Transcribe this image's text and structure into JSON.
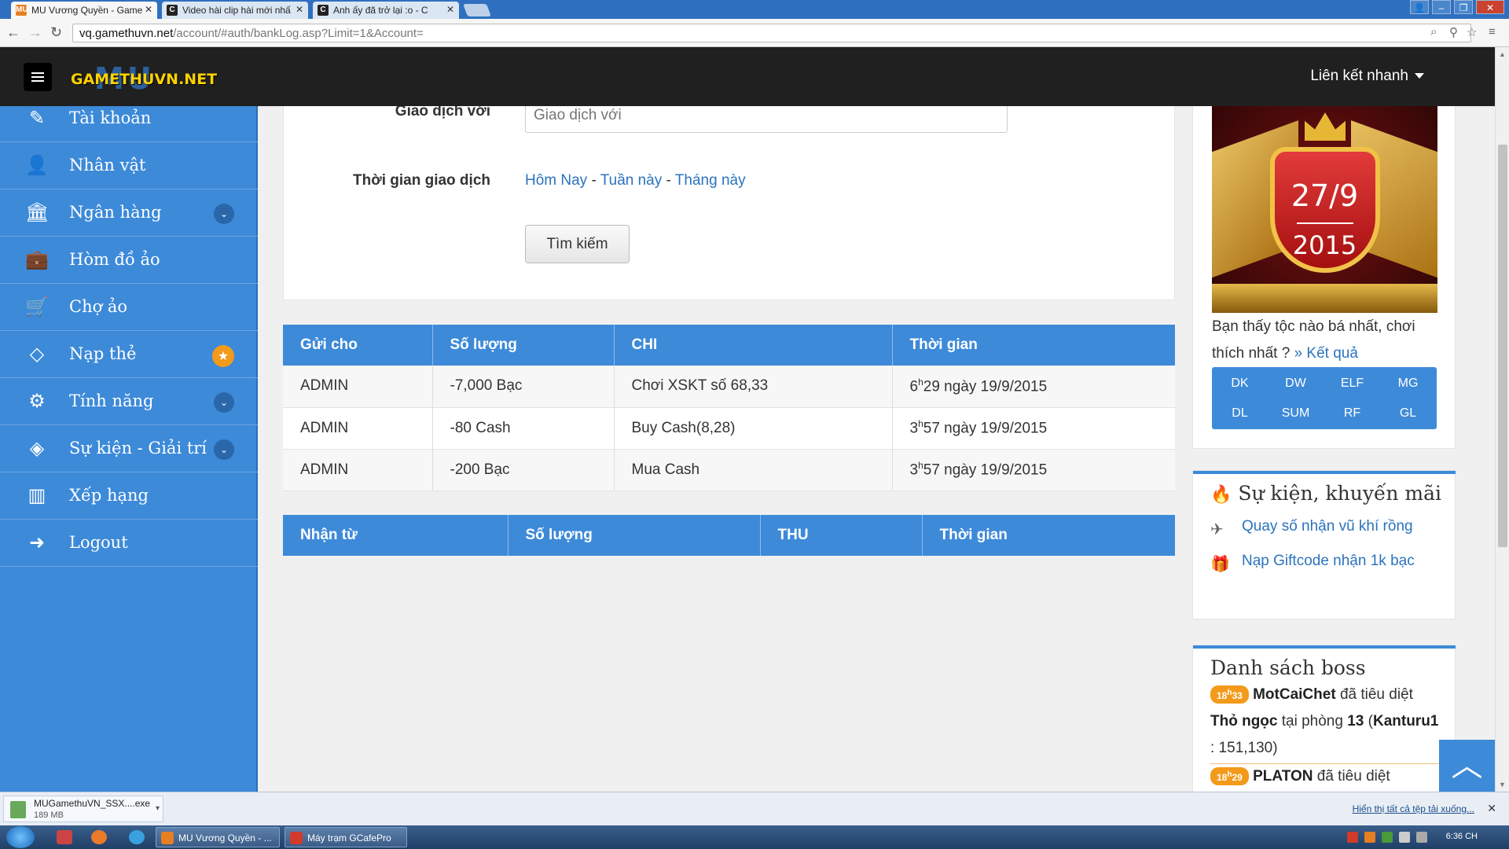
{
  "browser": {
    "tabs": [
      {
        "title": "MU Vương Quyền - Game",
        "favicon": "MU",
        "fav_color": "#e67f22",
        "active": true
      },
      {
        "title": "Video hài clip hài mới nhấ",
        "favicon": "C",
        "fav_color": "#222222",
        "active": false
      },
      {
        "title": "Anh ấy đã trở lại :o - C",
        "favicon": "C",
        "fav_color": "#222222",
        "active": false
      }
    ],
    "url_host": "vq.gamethuvn.net",
    "url_path": "/account/#auth/bankLog.asp?Limit=1&Account="
  },
  "header": {
    "logo_text": "GAMETHUVN.NET",
    "logo_overlay": "MU",
    "quick_links_label": "Liên kết nhanh"
  },
  "sidebar": {
    "items": [
      {
        "label": "Tài khoản",
        "icon": "edit-icon",
        "glyph": "✎",
        "badge": ""
      },
      {
        "label": "Nhân vật",
        "icon": "user-icon",
        "glyph": "👤",
        "badge": ""
      },
      {
        "label": "Ngân hàng",
        "icon": "bank-icon",
        "glyph": "🏛",
        "badge": "chevron"
      },
      {
        "label": "Hòm đồ ảo",
        "icon": "briefcase-icon",
        "glyph": "💼",
        "badge": ""
      },
      {
        "label": "Chợ ảo",
        "icon": "cart-icon",
        "glyph": "🛒",
        "badge": ""
      },
      {
        "label": "Nạp thẻ",
        "icon": "diamond-icon",
        "glyph": "◇",
        "badge": "star"
      },
      {
        "label": "Tính năng",
        "icon": "gears-icon",
        "glyph": "⚙",
        "badge": "chevron"
      },
      {
        "label": "Sự kiện - Giải trí",
        "icon": "code-icon",
        "glyph": "◈",
        "badge": "chevron"
      },
      {
        "label": "Xếp hạng",
        "icon": "bar-chart-icon",
        "glyph": "▥",
        "badge": ""
      },
      {
        "label": "Logout",
        "icon": "sign-out-icon",
        "glyph": "➜",
        "badge": ""
      }
    ]
  },
  "form": {
    "partner_label": "Giao dịch với",
    "partner_placeholder": "Giao dịch với",
    "time_label": "Thời gian giao dịch",
    "quick_today": "Hôm Nay",
    "quick_week": "Tuần này",
    "quick_month": "Tháng này",
    "quick_sep": " - ",
    "search_button": "Tìm kiếm"
  },
  "sent_table": {
    "headers": [
      "Gửi cho",
      "Số lượng",
      "CHI",
      "Thời gian"
    ],
    "rows": [
      {
        "to": "ADMIN",
        "amount": "-7,000  Bạc",
        "note": "Chơi XSKT số 68,33",
        "hour": "6",
        "time_rest": "29 ngày 19/9/2015"
      },
      {
        "to": "ADMIN",
        "amount": "-80  Cash",
        "note": "Buy Cash(8,28)",
        "hour": "3",
        "time_rest": "57 ngày 19/9/2015"
      },
      {
        "to": "ADMIN",
        "amount": "-200  Bạc",
        "note": "Mua Cash",
        "hour": "3",
        "time_rest": "57 ngày 19/9/2015"
      }
    ]
  },
  "received_table": {
    "headers": [
      "Nhận từ",
      "Số lượng",
      "THU",
      "Thời gian"
    ]
  },
  "right": {
    "promo_date": "27/9",
    "promo_year": "2015",
    "poll_text": "Bạn thấy tộc nào bá nhất, chơi thích nhất ?",
    "poll_link": "» Kết quả",
    "classes": [
      "DK",
      "DW",
      "ELF",
      "MG",
      "DL",
      "SUM",
      "RF",
      "GL"
    ],
    "events_title": "Sự kiện, khuyến mãi",
    "events": [
      {
        "text": "Quay số nhận vũ khí rồng",
        "icon": "plane-icon",
        "glyph": "✈"
      },
      {
        "text": "Nạp Giftcode nhận 1k bạc",
        "icon": "gift-icon",
        "glyph": "🎁"
      }
    ],
    "boss_title": "Danh sách boss",
    "boss": [
      {
        "h": "18",
        "m": "33",
        "player": "MotCaiChet",
        "action": "đã tiêu diệt",
        "boss": "Thỏ ngọc",
        "room_text": "tại phòng",
        "room": "13",
        "map": "Kanturu1",
        "coords": ": 151,130)"
      },
      {
        "h": "18",
        "m": "29",
        "player": "PLATON",
        "action": "đã tiêu diệt",
        "boss": "",
        "room_text": "",
        "room": "",
        "map": "",
        "coords": ""
      }
    ]
  },
  "download": {
    "file": "MUGamethuVN_SSX....exe",
    "size": "189 MB",
    "show_all": "Hiển thị tất cả tệp tải xuống..."
  },
  "taskbar": {
    "tasks": [
      {
        "label": "MU Vương Quyền - ...",
        "color": "#e67f22"
      },
      {
        "label": "Máy trạm GCafePro",
        "color": "#d23a2a"
      }
    ],
    "clock": "6:36 CH"
  }
}
